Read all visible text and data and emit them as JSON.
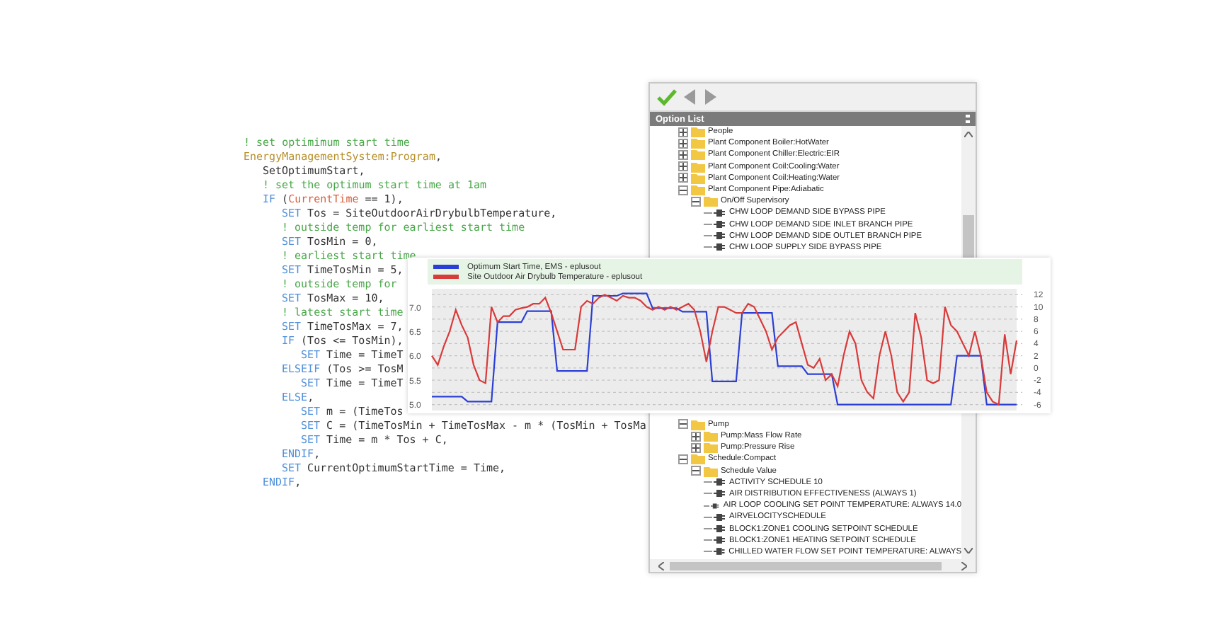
{
  "code": {
    "lines": [
      {
        "parts": [
          {
            "kind": "comment",
            "text": "! set optimimum start time"
          }
        ]
      },
      {
        "parts": [
          {
            "kind": "object",
            "text": "EnergyManagementSystem:Program"
          },
          {
            "kind": "plain",
            "text": ","
          }
        ],
        "children": [
          {
            "parts": [
              {
                "kind": "plain",
                "text": "SetOptimumStart,"
              }
            ]
          },
          {
            "parts": [
              {
                "kind": "comment",
                "text": "! set the optimum start time at 1am"
              }
            ]
          },
          {
            "parts": [
              {
                "kind": "keyword",
                "text": "IF"
              },
              {
                "kind": "plain",
                "text": " ("
              },
              {
                "kind": "variable",
                "text": "CurrentTime"
              },
              {
                "kind": "plain",
                "text": " == 1),"
              }
            ],
            "children": [
              {
                "parts": [
                  {
                    "kind": "keyword",
                    "text": "SET"
                  },
                  {
                    "kind": "plain",
                    "text": " Tos = SiteOutdoorAirDrybulbTemperature,"
                  }
                ]
              },
              {
                "parts": [
                  {
                    "kind": "comment",
                    "text": "! outside temp for earliest start time"
                  }
                ]
              },
              {
                "parts": [
                  {
                    "kind": "keyword",
                    "text": "SET"
                  },
                  {
                    "kind": "plain",
                    "text": " TosMin = 0,"
                  }
                ]
              },
              {
                "parts": [
                  {
                    "kind": "comment",
                    "text": "! earliest start time"
                  }
                ]
              },
              {
                "parts": [
                  {
                    "kind": "keyword",
                    "text": "SET"
                  },
                  {
                    "kind": "plain",
                    "text": " TimeTosMin = 5,"
                  }
                ]
              },
              {
                "parts": [
                  {
                    "kind": "comment",
                    "text": "! outside temp for"
                  }
                ]
              },
              {
                "parts": [
                  {
                    "kind": "keyword",
                    "text": "SET"
                  },
                  {
                    "kind": "plain",
                    "text": " TosMax = 10,"
                  }
                ]
              },
              {
                "parts": [
                  {
                    "kind": "comment",
                    "text": "! latest start time"
                  }
                ]
              },
              {
                "parts": [
                  {
                    "kind": "keyword",
                    "text": "SET"
                  },
                  {
                    "kind": "plain",
                    "text": " TimeTosMax = 7,"
                  }
                ]
              },
              {
                "parts": [
                  {
                    "kind": "keyword",
                    "text": "IF"
                  },
                  {
                    "kind": "plain",
                    "text": " (Tos <= TosMin),"
                  }
                ],
                "children": [
                  {
                    "parts": [
                      {
                        "kind": "keyword",
                        "text": "SET"
                      },
                      {
                        "kind": "plain",
                        "text": " Time = TimeT"
                      }
                    ]
                  }
                ]
              },
              {
                "parts": [
                  {
                    "kind": "keyword",
                    "text": "ELSEIF"
                  },
                  {
                    "kind": "plain",
                    "text": " (Tos >= TosM"
                  }
                ],
                "children": [
                  {
                    "parts": [
                      {
                        "kind": "keyword",
                        "text": "SET"
                      },
                      {
                        "kind": "plain",
                        "text": " Time = TimeT"
                      }
                    ]
                  }
                ]
              },
              {
                "parts": [
                  {
                    "kind": "keyword",
                    "text": "ELSE"
                  },
                  {
                    "kind": "plain",
                    "text": ","
                  }
                ],
                "children": [
                  {
                    "parts": [
                      {
                        "kind": "keyword",
                        "text": "SET"
                      },
                      {
                        "kind": "plain",
                        "text": " m = (TimeTos"
                      }
                    ]
                  },
                  {
                    "parts": [
                      {
                        "kind": "keyword",
                        "text": "SET"
                      },
                      {
                        "kind": "plain",
                        "text": " C = (TimeTosMin + TimeTosMax - m * (TosMin + TosMa"
                      }
                    ]
                  },
                  {
                    "parts": [
                      {
                        "kind": "keyword",
                        "text": "SET"
                      },
                      {
                        "kind": "plain",
                        "text": " Time = m * Tos + C,"
                      }
                    ]
                  }
                ]
              },
              {
                "parts": [
                  {
                    "kind": "keyword",
                    "text": "ENDIF"
                  },
                  {
                    "kind": "plain",
                    "text": ","
                  }
                ]
              },
              {
                "parts": [
                  {
                    "kind": "keyword",
                    "text": "SET"
                  },
                  {
                    "kind": "plain",
                    "text": " CurrentOptimumStartTime = Time,"
                  }
                ]
              }
            ]
          },
          {
            "parts": [
              {
                "kind": "keyword",
                "text": "ENDIF"
              },
              {
                "kind": "plain",
                "text": ","
              }
            ]
          }
        ]
      }
    ]
  },
  "option_list": {
    "title": "Option List",
    "tree_upper": [
      {
        "kind": "folder",
        "label": "People",
        "expanded": false
      },
      {
        "kind": "folder",
        "label": "Plant Component Boiler:HotWater",
        "expanded": false
      },
      {
        "kind": "folder",
        "label": "Plant Component Chiller:Electric:EIR",
        "expanded": false
      },
      {
        "kind": "folder",
        "label": "Plant Component Coil:Cooling:Water",
        "expanded": false
      },
      {
        "kind": "folder",
        "label": "Plant Component Coil:Heating:Water",
        "expanded": false
      },
      {
        "kind": "folder",
        "label": "Plant Component Pipe:Adiabatic",
        "expanded": true,
        "children": [
          {
            "kind": "folder",
            "label": "On/Off Supervisory",
            "expanded": true,
            "children": [
              {
                "kind": "leaf",
                "label": "CHW LOOP DEMAND SIDE BYPASS PIPE"
              },
              {
                "kind": "leaf",
                "label": "CHW LOOP DEMAND SIDE INLET BRANCH PIPE"
              },
              {
                "kind": "leaf",
                "label": "CHW LOOP DEMAND SIDE OUTLET BRANCH PIPE"
              },
              {
                "kind": "leaf",
                "label": "CHW LOOP SUPPLY SIDE BYPASS PIPE"
              }
            ]
          }
        ]
      }
    ],
    "tree_lower": [
      {
        "kind": "folder",
        "label": "Pump",
        "expanded": true,
        "children": [
          {
            "kind": "folder",
            "label": "Pump:Mass Flow Rate",
            "expanded": false
          },
          {
            "kind": "folder",
            "label": "Pump:Pressure Rise",
            "expanded": false
          }
        ]
      },
      {
        "kind": "folder",
        "label": "Schedule:Compact",
        "expanded": true,
        "children": [
          {
            "kind": "folder",
            "label": "Schedule Value",
            "expanded": true,
            "children": [
              {
                "kind": "leaf",
                "label": "ACTIVITY SCHEDULE 10"
              },
              {
                "kind": "leaf",
                "label": "AIR DISTRIBUTION EFFECTIVENESS (ALWAYS 1)"
              },
              {
                "kind": "leaf",
                "label": "AIR LOOP COOLING SET POINT TEMPERATURE: ALWAYS 14.0"
              },
              {
                "kind": "leaf",
                "label": "AIRVELOCITYSCHEDULE"
              },
              {
                "kind": "leaf",
                "label": "BLOCK1:ZONE1 COOLING SETPOINT SCHEDULE"
              },
              {
                "kind": "leaf",
                "label": "BLOCK1:ZONE1 HEATING SETPOINT SCHEDULE"
              },
              {
                "kind": "leaf",
                "label": "CHILLED WATER FLOW SET POINT TEMPERATURE: ALWAYS"
              }
            ]
          }
        ]
      }
    ]
  },
  "chart": {
    "secondary_yticks": [
      "7.0",
      "6.5",
      "6.0",
      "5.5",
      "5.0"
    ],
    "chart_data": {
      "type": "line",
      "grid": true,
      "ylim": [
        -6.5,
        12.5
      ],
      "yticks": [
        {
          "value": 12,
          "label": "12"
        },
        {
          "value": 10,
          "label": "10"
        },
        {
          "value": 8,
          "label": "8"
        },
        {
          "value": 6,
          "label": "6"
        },
        {
          "value": 4,
          "label": "4"
        },
        {
          "value": 2,
          "label": "2"
        },
        {
          "value": 0,
          "label": "0"
        },
        {
          "value": -2,
          "label": "-2"
        },
        {
          "value": -4,
          "label": "-4"
        },
        {
          "value": -6,
          "label": "-6"
        }
      ],
      "categories": [
        null,
        null,
        null,
        null,
        null,
        null,
        null,
        null,
        null,
        null,
        null,
        null,
        null,
        null,
        null,
        null,
        null,
        null,
        null,
        null,
        null,
        null,
        null,
        null,
        null,
        null,
        null,
        null,
        null,
        null,
        null,
        null,
        null,
        null,
        null,
        null,
        null,
        null,
        null,
        null,
        null,
        null,
        null,
        null,
        null,
        null,
        null,
        null,
        null,
        null,
        null,
        null,
        null,
        null,
        null,
        null,
        null,
        null,
        null,
        null,
        null,
        null,
        null,
        null,
        null,
        null,
        null,
        null,
        null,
        null,
        null,
        null,
        null,
        null,
        null,
        null,
        null,
        null,
        null,
        null,
        null,
        null,
        null,
        null,
        null,
        null,
        null,
        null,
        null,
        null,
        null,
        null,
        null,
        null,
        null,
        null,
        null,
        null,
        null
      ],
      "series": [
        {
          "name": "Optimum Start Time, EMS - eplusout",
          "color": "#2b3fd6",
          "values": [
            -4.7,
            -4.7,
            -4.7,
            -4.7,
            -4.7,
            -4.7,
            -5.5,
            -5.5,
            -5.5,
            -5.5,
            -5.5,
            7.5,
            7.5,
            7.5,
            7.5,
            7.5,
            9.3,
            9.3,
            9.3,
            9.3,
            9.3,
            -0.5,
            -0.5,
            -0.5,
            -0.5,
            -0.5,
            -0.5,
            11.8,
            11.8,
            11.8,
            11.8,
            11.8,
            12.2,
            12.2,
            12.2,
            12.2,
            12.2,
            9.8,
            9.8,
            9.8,
            9.8,
            9.8,
            9.2,
            9.2,
            9.2,
            9.2,
            9.2,
            -2.2,
            -2.2,
            -2.2,
            -2.2,
            -2.2,
            9,
            9,
            9,
            9,
            9,
            9,
            0.3,
            0.3,
            0.3,
            0.3,
            0.3,
            -1,
            -1,
            -1,
            -1,
            -1,
            -6,
            -6,
            -6,
            -6,
            -6,
            -6,
            -6,
            -6,
            -6,
            -6,
            -6,
            -6,
            -6,
            -6,
            -6,
            -6,
            -6,
            -6,
            -6,
            -6,
            2,
            2,
            2,
            2,
            2,
            -6,
            -6,
            -6,
            -6,
            -6,
            -6
          ]
        },
        {
          "name": "Site Outdoor Air Drybulb Temperature - eplusout",
          "color": "#d93a3a",
          "values": [
            2,
            0.5,
            3.5,
            6,
            9.5,
            7,
            5,
            0.5,
            -2,
            -2.5,
            10,
            7.5,
            8.5,
            8.5,
            9.5,
            9.8,
            10,
            10.5,
            10.5,
            11.5,
            9,
            6,
            3,
            3,
            3,
            10,
            11,
            10.5,
            11.5,
            12,
            11.5,
            11,
            11.8,
            11.5,
            11.5,
            11,
            10,
            9.5,
            10,
            9.5,
            10,
            9.5,
            10,
            10.5,
            9.5,
            6,
            1,
            6,
            10,
            10,
            9.5,
            9,
            9,
            10.5,
            10,
            8,
            6,
            3,
            5,
            6,
            7,
            7.5,
            4,
            0.5,
            0,
            1.5,
            -2,
            -1,
            -3,
            2,
            6,
            4,
            -2,
            -4,
            -5,
            2,
            6,
            2,
            -4,
            -5.5,
            -4,
            9,
            5,
            -2,
            -2.5,
            -2,
            10,
            7,
            6,
            4,
            2,
            6,
            2,
            -4,
            -5.5,
            -6,
            5.5,
            -1,
            4.5
          ]
        }
      ]
    }
  }
}
